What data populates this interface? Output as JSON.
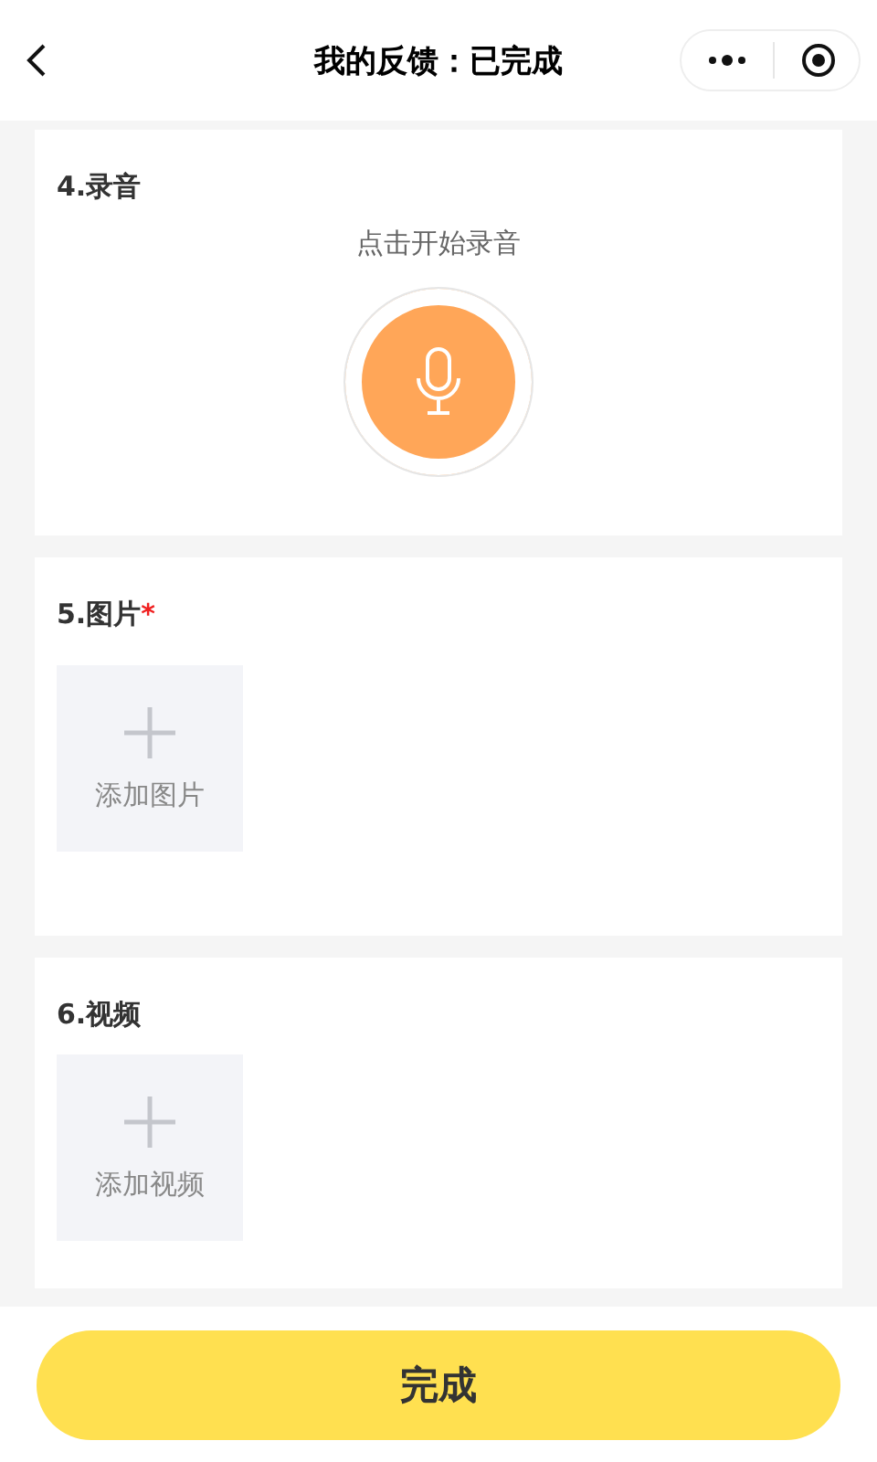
{
  "nav": {
    "title": "我的反馈：已完成"
  },
  "sections": [
    {
      "kind": "recording",
      "title": "4.录音",
      "prompt": "点击开始录音"
    },
    {
      "kind": "upload",
      "title": "5.图片",
      "required_mark": "*",
      "upload_label": "添加图片"
    },
    {
      "kind": "upload",
      "title": "6.视频",
      "upload_label": "添加视频"
    }
  ],
  "footer": {
    "button": "完成"
  }
}
